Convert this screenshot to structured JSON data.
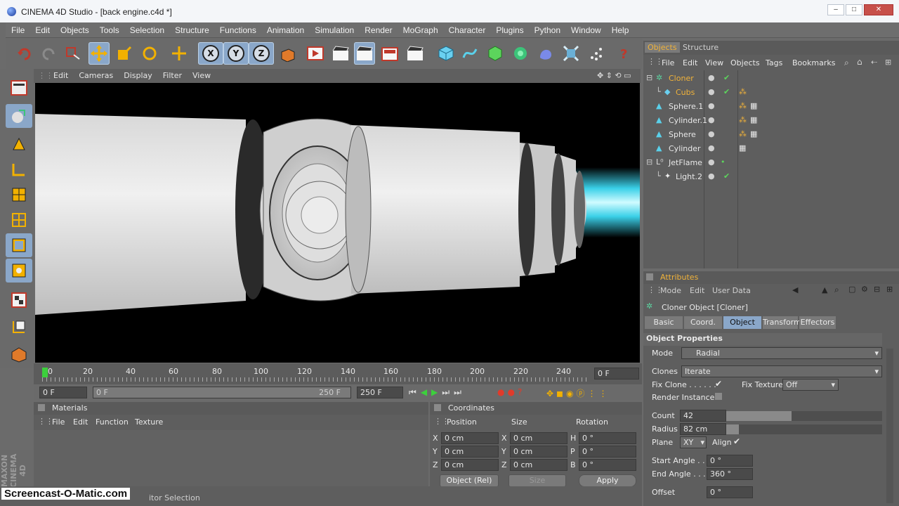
{
  "title": "CINEMA 4D Studio - [back engine.c4d *]",
  "window_controls": {
    "minimize": "–",
    "maximize": "□",
    "close": "✕"
  },
  "menu": [
    "File",
    "Edit",
    "Objects",
    "Tools",
    "Selection",
    "Structure",
    "Functions",
    "Animation",
    "Simulation",
    "Render",
    "MoGraph",
    "Character",
    "Plugins",
    "Python",
    "Window",
    "Help"
  ],
  "axes": {
    "x": "X",
    "y": "Y",
    "z": "Z"
  },
  "viewport": {
    "menu": [
      "Edit",
      "Cameras",
      "Display",
      "Filter",
      "View"
    ]
  },
  "timeline": {
    "ticks": [
      "0",
      "20",
      "40",
      "60",
      "80",
      "100",
      "120",
      "140",
      "160",
      "180",
      "200",
      "220",
      "240"
    ],
    "current_frame": "0 F",
    "start": "0 F",
    "slider_start": "0 F",
    "slider_end": "250 F",
    "end": "250 F"
  },
  "materials": {
    "title": "Materials",
    "menu": [
      "File",
      "Edit",
      "Function",
      "Texture"
    ]
  },
  "coordinates": {
    "title": "Coordinates",
    "headers": [
      "Position",
      "Size",
      "Rotation"
    ],
    "rows": [
      {
        "a": "X",
        "pos": "0 cm",
        "b": "X",
        "size": "0 cm",
        "c": "H",
        "rot": "0 °"
      },
      {
        "a": "Y",
        "pos": "0 cm",
        "b": "Y",
        "size": "0 cm",
        "c": "P",
        "rot": "0 °"
      },
      {
        "a": "Z",
        "pos": "0 cm",
        "b": "Z",
        "size": "0 cm",
        "c": "B",
        "rot": "0 °"
      }
    ],
    "mode": "Object (Rel)",
    "size_mode": "Size",
    "apply": "Apply"
  },
  "objects_panel": {
    "tabs": [
      "Objects",
      "Structure"
    ],
    "menu": [
      "File",
      "Edit",
      "View",
      "Objects",
      "Tags",
      "Bookmarks"
    ],
    "items": [
      {
        "name": "Cloner",
        "icon": "cloner-icon",
        "selected": true
      },
      {
        "name": "Cubs",
        "icon": "cube-icon",
        "selected": true
      },
      {
        "name": "Sphere.1",
        "icon": "sweep-icon"
      },
      {
        "name": "Cylinder.1",
        "icon": "sweep-icon"
      },
      {
        "name": "Sphere",
        "icon": "sweep-icon"
      },
      {
        "name": "Cylinder",
        "icon": "sweep-icon"
      },
      {
        "name": "JetFlame",
        "icon": "null-icon"
      },
      {
        "name": "Light.2",
        "icon": "light-icon"
      }
    ]
  },
  "attributes": {
    "title": "Attributes",
    "menu": [
      "Mode",
      "Edit",
      "User Data"
    ],
    "object_title": "Cloner Object [Cloner]",
    "tabs": [
      "Basic",
      "Coord.",
      "Object",
      "Transform",
      "Effectors"
    ],
    "section": "Object Properties",
    "mode_label": "Mode",
    "mode_value": "Radial",
    "clones_label": "Clones",
    "clones_value": "Iterate",
    "fix_clone_label": "Fix Clone . . . . . .",
    "fix_texture_label": "Fix Texture",
    "fix_texture_value": "Off",
    "render_instances_label": "Render Instances",
    "count_label": "Count",
    "count_value": "42",
    "count_fraction": 0.42,
    "radius_label": "Radius",
    "radius_value": "82 cm",
    "radius_fraction": 0.08,
    "plane_label": "Plane",
    "plane_value": "XY",
    "align_label": "Align",
    "start_angle_label": "Start Angle . . .",
    "start_angle_value": "0 °",
    "end_angle_label": "End Angle . . . .",
    "end_angle_value": "360 °",
    "offset_label": "Offset",
    "offset_value": "0 °"
  },
  "status": {
    "text": "itor Selection",
    "watermark": "Screencast-O-Matic.com",
    "brand": "MAXON CINEMA 4D"
  }
}
